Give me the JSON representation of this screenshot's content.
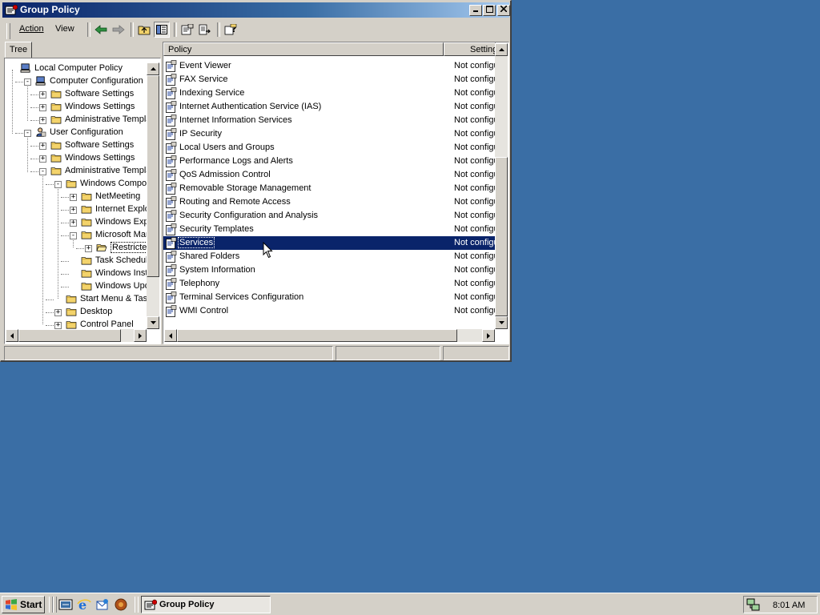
{
  "window": {
    "title": "Group Policy",
    "controls": {
      "minimize": "_",
      "maximize": "□",
      "close": "×"
    }
  },
  "menu": {
    "action": "Action",
    "view": "View"
  },
  "toolbar": {
    "buttons": [
      "back-icon",
      "forward-icon",
      "up-one-level-icon",
      "show-hide-tree-icon",
      "properties-icon",
      "export-list-icon",
      "help-icon"
    ]
  },
  "tree": {
    "tab": "Tree",
    "items": [
      {
        "label": "Local Computer Policy",
        "expander": ""
      },
      {
        "label": "Computer Configuration",
        "expander": "−"
      },
      {
        "label": "Software Settings",
        "expander": "+"
      },
      {
        "label": "Windows Settings",
        "expander": "+"
      },
      {
        "label": "Administrative Templates",
        "expander": "+"
      },
      {
        "label": "User Configuration",
        "expander": "−"
      },
      {
        "label": "Software Settings",
        "expander": "+"
      },
      {
        "label": "Windows Settings",
        "expander": "+"
      },
      {
        "label": "Administrative Templates",
        "expander": "−"
      },
      {
        "label": "Windows Components",
        "expander": "−"
      },
      {
        "label": "NetMeeting",
        "expander": "+"
      },
      {
        "label": "Internet Explorer",
        "expander": "+"
      },
      {
        "label": "Windows Explorer",
        "expander": "+"
      },
      {
        "label": "Microsoft Management Console",
        "expander": "−"
      },
      {
        "label": "Restricted/Permitted snap-ins",
        "expander": "+"
      },
      {
        "label": "Task Scheduler",
        "expander": ""
      },
      {
        "label": "Windows Installer",
        "expander": ""
      },
      {
        "label": "Windows Update",
        "expander": ""
      },
      {
        "label": "Start Menu & Taskbar",
        "expander": ""
      },
      {
        "label": "Desktop",
        "expander": "+"
      },
      {
        "label": "Control Panel",
        "expander": "+"
      }
    ]
  },
  "list": {
    "columns": {
      "policy": "Policy",
      "setting": "Setting"
    },
    "rows": [
      {
        "policy": "Event Viewer",
        "setting": "Not configured"
      },
      {
        "policy": "FAX Service",
        "setting": "Not configured"
      },
      {
        "policy": "Indexing Service",
        "setting": "Not configured"
      },
      {
        "policy": "Internet Authentication Service (IAS)",
        "setting": "Not configured"
      },
      {
        "policy": "Internet Information Services",
        "setting": "Not configured"
      },
      {
        "policy": "IP Security",
        "setting": "Not configured"
      },
      {
        "policy": "Local Users and Groups",
        "setting": "Not configured"
      },
      {
        "policy": "Performance Logs and Alerts",
        "setting": "Not configured"
      },
      {
        "policy": "QoS Admission Control",
        "setting": "Not configured"
      },
      {
        "policy": "Removable Storage Management",
        "setting": "Not configured"
      },
      {
        "policy": "Routing and Remote Access",
        "setting": "Not configured"
      },
      {
        "policy": "Security Configuration and Analysis",
        "setting": "Not configured"
      },
      {
        "policy": "Security Templates",
        "setting": "Not configured"
      },
      {
        "policy": "Services",
        "setting": "Not configured",
        "selected": true
      },
      {
        "policy": "Shared Folders",
        "setting": "Not configured"
      },
      {
        "policy": "System Information",
        "setting": "Not configured"
      },
      {
        "policy": "Telephony",
        "setting": "Not configured"
      },
      {
        "policy": "Terminal Services Configuration",
        "setting": "Not configured"
      },
      {
        "policy": "WMI Control",
        "setting": "Not configured"
      }
    ]
  },
  "taskbar": {
    "start": "Start",
    "quicklaunch": [
      "show-desktop-icon",
      "internet-explorer-icon",
      "outlook-express-icon",
      "media-player-icon"
    ],
    "task": "Group Policy",
    "clock": "8:01 AM"
  },
  "colors": {
    "desktop": "#3a6ea5",
    "selection": "#0a246a",
    "face": "#d4d0c8"
  }
}
